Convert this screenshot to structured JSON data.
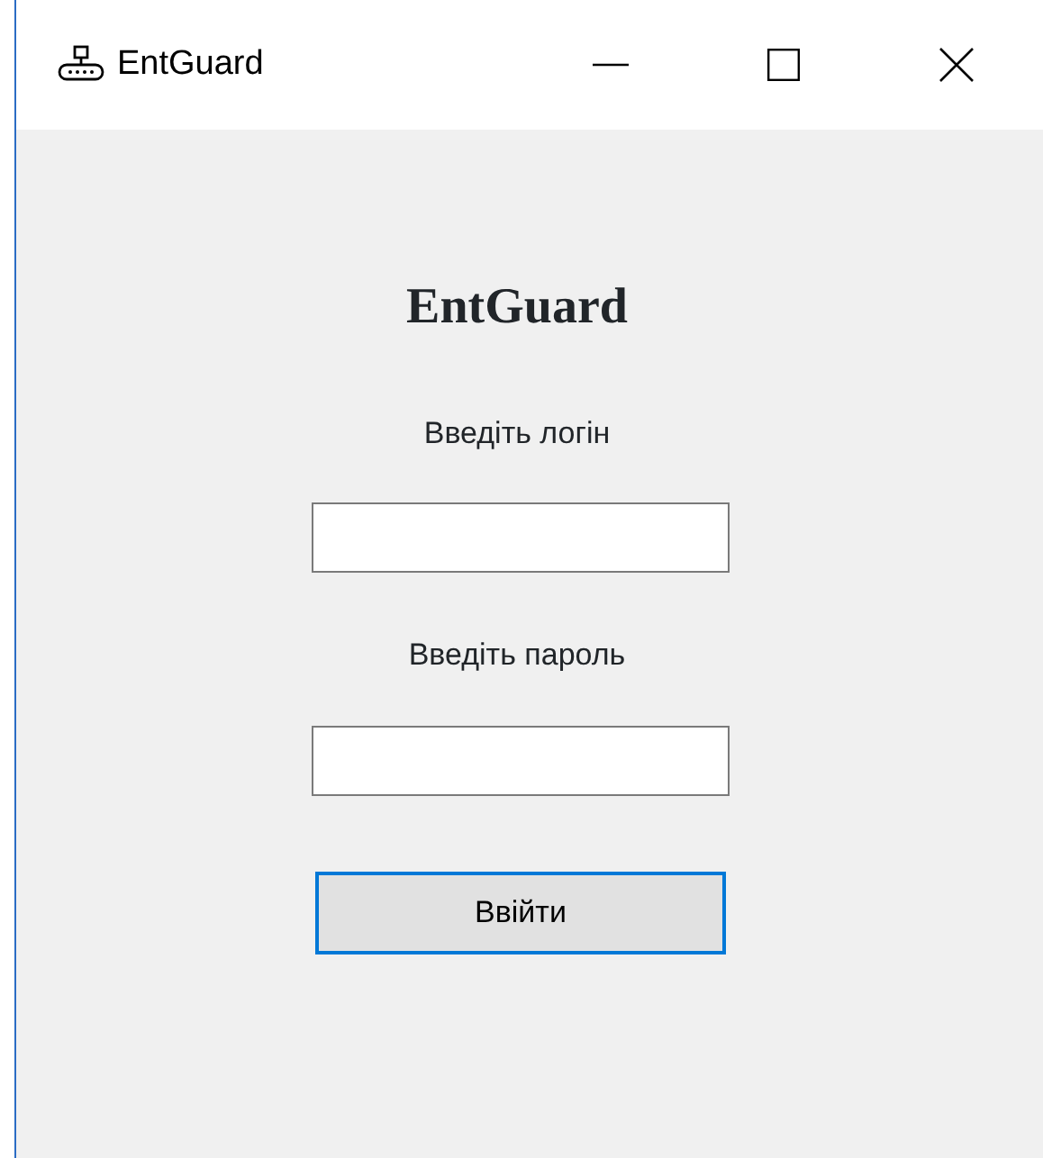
{
  "window": {
    "title": "EntGuard"
  },
  "heading": "EntGuard",
  "fields": [
    {
      "label": "Введіть логін"
    },
    {
      "label": "Введіть пароль"
    }
  ],
  "button": {
    "label": "Ввійти",
    "focused": true
  }
}
